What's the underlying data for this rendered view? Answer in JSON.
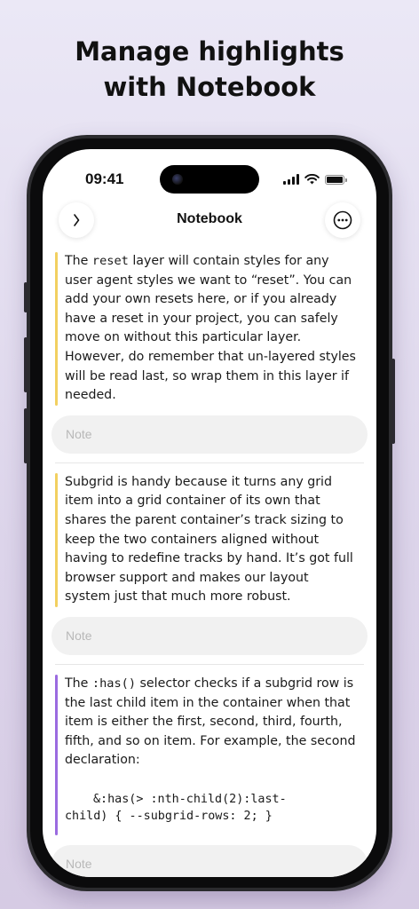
{
  "headline": {
    "line1": "Manage highlights",
    "line2": "with Notebook"
  },
  "status_bar": {
    "time": "09:41"
  },
  "nav": {
    "title": "Notebook",
    "back_icon": "chevron-right-icon",
    "more_icon": "ellipsis-circle-icon"
  },
  "highlights": [
    {
      "color": "#f2d060",
      "text_before": "The ",
      "code": "reset",
      "text_after": " layer will contain styles for any user agent styles we want to “reset”. You can add your own resets here, or if you already have a reset in your project, you can safely move on without this particular layer. However, do remember that un-layered styles will be read last, so wrap them in this layer if needed.",
      "note_placeholder": "Note"
    },
    {
      "color": "#f2d060",
      "text": "Subgrid is handy because it turns any grid item into a grid container of its own that shares the parent container’s track sizing to keep the two containers aligned without having to redefine tracks by hand. It’s got full browser support and makes our layout system just that much more robust.",
      "note_placeholder": "Note"
    },
    {
      "color": "#9b6be0",
      "text_before": "The ",
      "code": ":has()",
      "text_after": " selector checks if a subgrid row is the last child item in the container when that item is either the first, second, third, fourth, fifth, and so on item. For example, the second declaration:",
      "code_line1": "&:has(> :nth-child(2):last-",
      "code_line2": "child) { --subgrid-rows: 2; }",
      "note_placeholder": "Note"
    }
  ]
}
